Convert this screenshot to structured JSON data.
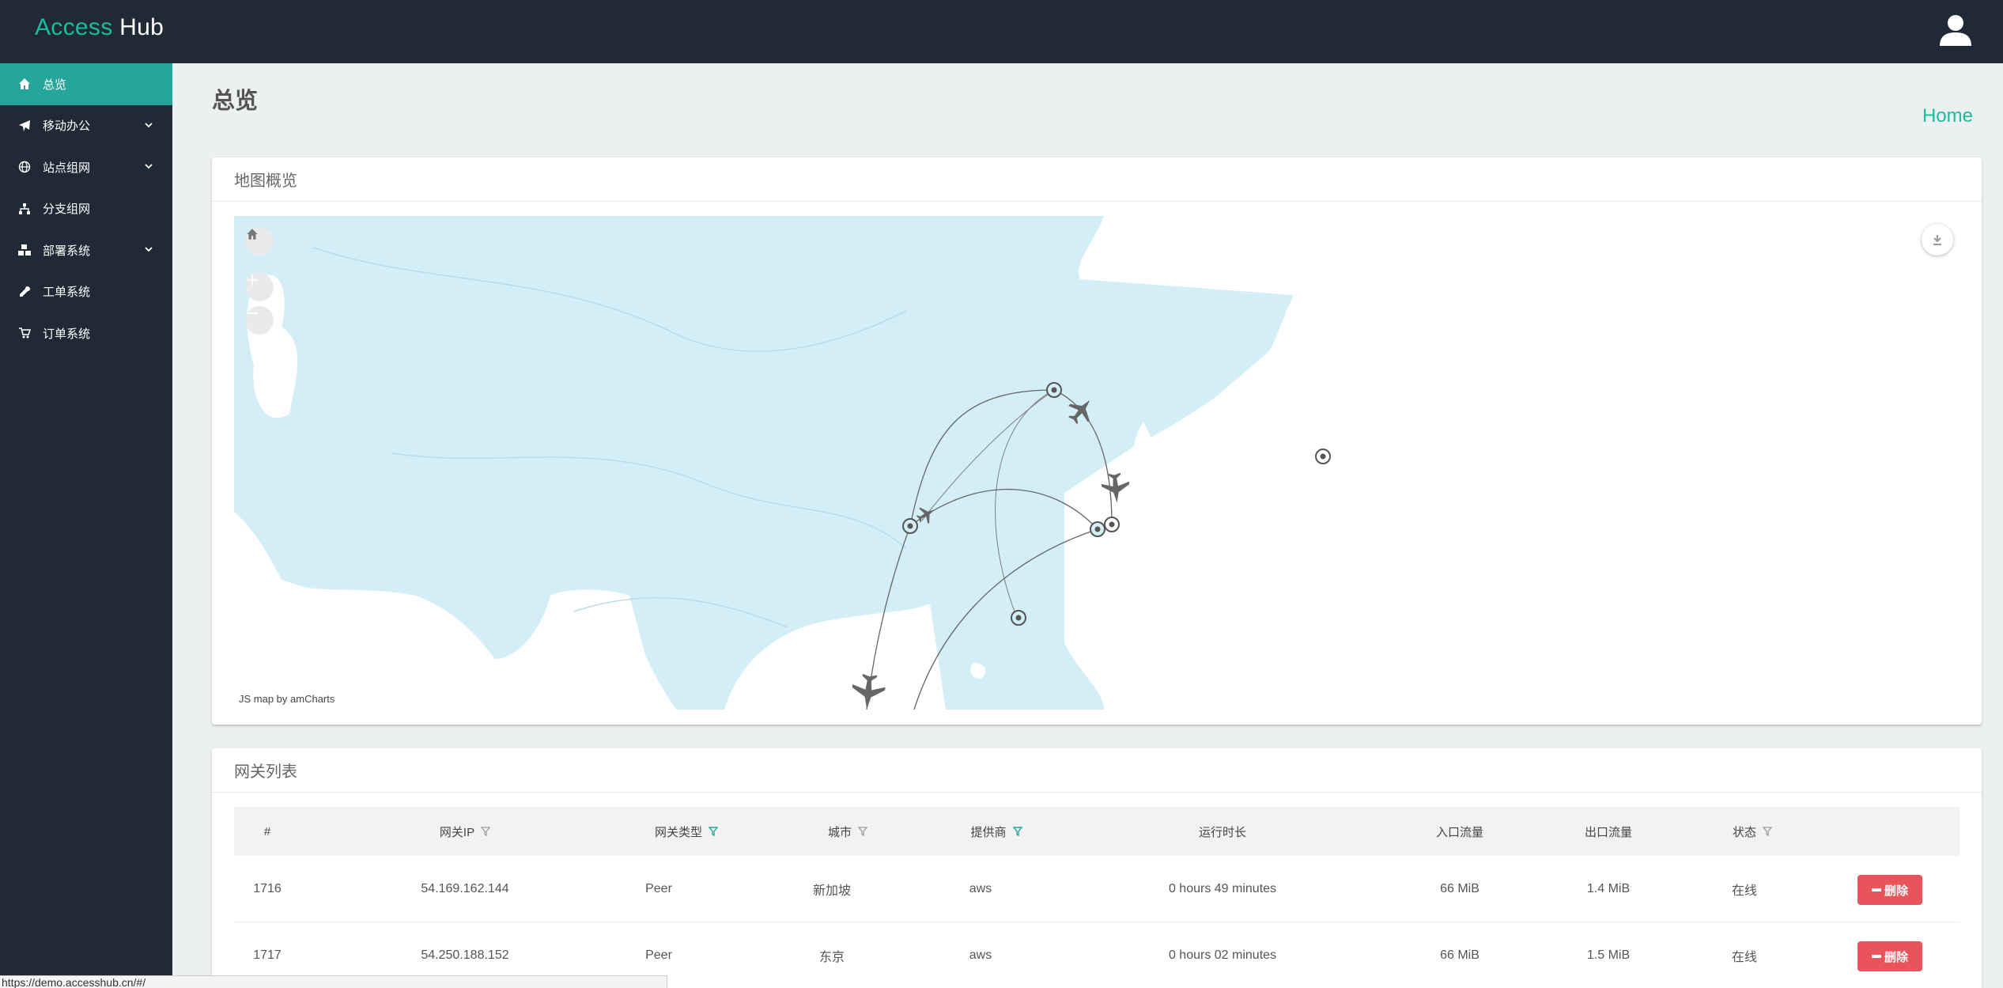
{
  "header": {
    "brand_accent": "Access",
    "brand_rest": "Hub",
    "avatar_icon": "user-avatar-icon"
  },
  "sidebar": {
    "items": [
      {
        "label": "总览",
        "icon": "home-icon",
        "active": true,
        "has_submenu": false
      },
      {
        "label": "移动办公",
        "icon": "plane-icon",
        "active": false,
        "has_submenu": true
      },
      {
        "label": "站点组网",
        "icon": "globe-icon",
        "active": false,
        "has_submenu": true
      },
      {
        "label": "分支组网",
        "icon": "sitemap-icon",
        "active": false,
        "has_submenu": false
      },
      {
        "label": "部署系统",
        "icon": "cubes-icon",
        "active": false,
        "has_submenu": true
      },
      {
        "label": "工单系统",
        "icon": "wrench-icon",
        "active": false,
        "has_submenu": false
      },
      {
        "label": "订单系统",
        "icon": "cart-icon",
        "active": false,
        "has_submenu": false
      }
    ]
  },
  "page": {
    "title": "总览",
    "breadcrumb": "Home"
  },
  "map_panel": {
    "title": "地图概览",
    "credit": "JS map by amCharts",
    "controls": [
      "home-icon",
      "zoom-in-icon",
      "zoom-out-icon",
      "download-icon"
    ]
  },
  "table": {
    "title": "网关列表",
    "columns": [
      {
        "label": "#",
        "filter": false
      },
      {
        "label": "网关IP",
        "filter": true,
        "filter_active": false
      },
      {
        "label": "网关类型",
        "filter": true,
        "filter_active": true
      },
      {
        "label": "城市",
        "filter": true,
        "filter_active": false
      },
      {
        "label": "提供商",
        "filter": true,
        "filter_active": true
      },
      {
        "label": "运行时长",
        "filter": false
      },
      {
        "label": "入口流量",
        "filter": false
      },
      {
        "label": "出口流量",
        "filter": false
      },
      {
        "label": "状态",
        "filter": true,
        "filter_active": false
      },
      {
        "label": "",
        "filter": false
      }
    ],
    "rows": [
      {
        "id": "1716",
        "ip": "54.169.162.144",
        "type": "Peer",
        "city": "新加坡",
        "provider": "aws",
        "uptime": "0 hours 49 minutes",
        "in": "66 MiB",
        "out": "1.4 MiB",
        "status": "在线",
        "action": "删除"
      },
      {
        "id": "1717",
        "ip": "54.250.188.152",
        "type": "Peer",
        "city": "东京",
        "provider": "aws",
        "uptime": "0 hours 02 minutes",
        "in": "66 MiB",
        "out": "1.5 MiB",
        "status": "在线",
        "action": "删除"
      }
    ]
  },
  "status_bar": {
    "url": "https://demo.accesshub.cn/#/"
  },
  "colors": {
    "accent": "#1abc9c",
    "sidebar_bg": "#1f2a36",
    "active_item": "#26a69a",
    "danger": "#e9535a",
    "filter_active": "#26a69a",
    "filter_inactive": "#999999",
    "map_water": "#d3eef7"
  }
}
